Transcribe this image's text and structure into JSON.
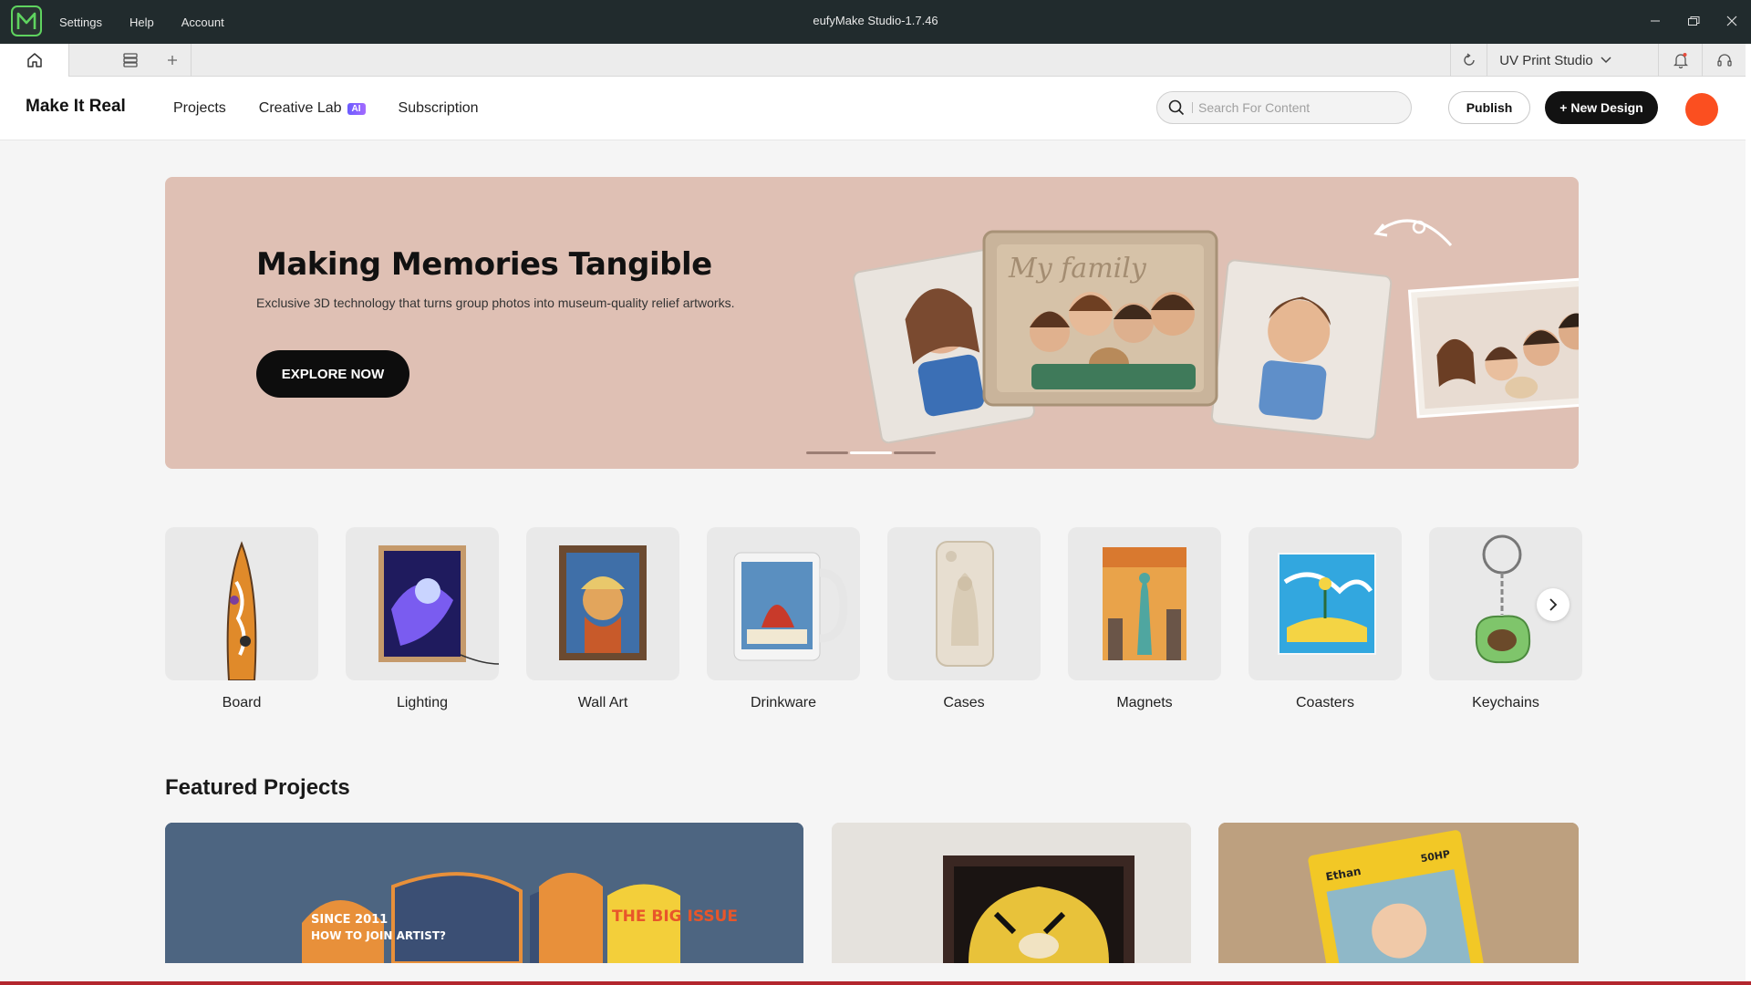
{
  "window": {
    "title": "eufyMake Studio-1.7.46",
    "menu": [
      "Settings",
      "Help",
      "Account"
    ]
  },
  "tabstrip": {
    "mode": "UV Print Studio"
  },
  "header": {
    "brand": "Make It Real",
    "nav": {
      "projects": "Projects",
      "creative_lab": "Creative Lab",
      "ai_badge": "AI",
      "subscription": "Subscription"
    },
    "search_placeholder": "Search For Content",
    "publish_label": "Publish",
    "new_design_label": "+ New Design",
    "avatar_color": "#fb4f20"
  },
  "hero": {
    "title": "Making Memories Tangible",
    "subtitle": "Exclusive 3D technology that turns group photos into museum-quality relief artworks.",
    "button": "EXPLORE NOW",
    "relief_text": "My family",
    "background": "#dfc0b4",
    "slide_count": 3,
    "active_slide": 2
  },
  "categories": [
    {
      "label": "Board",
      "icon": "surfboard-image"
    },
    {
      "label": "Lighting",
      "icon": "light-frame-image"
    },
    {
      "label": "Wall Art",
      "icon": "wall-art-image"
    },
    {
      "label": "Drinkware",
      "icon": "mug-image"
    },
    {
      "label": "Cases",
      "icon": "phone-case-image"
    },
    {
      "label": "Magnets",
      "icon": "magnet-image"
    },
    {
      "label": "Coasters",
      "icon": "coaster-image"
    },
    {
      "label": "Keychains",
      "icon": "keychain-image"
    }
  ],
  "featured": {
    "title": "Featured Projects",
    "cards": [
      {
        "icon": "skateboards-image",
        "texts": [
          "SINCE 2011",
          "HOW TO JOIN ARTIST?",
          "THE BIG ISSUE"
        ]
      },
      {
        "icon": "tiger-shadowbox-image"
      },
      {
        "icon": "trading-card-image",
        "texts": [
          "Ethan",
          "50HP"
        ]
      }
    ]
  }
}
